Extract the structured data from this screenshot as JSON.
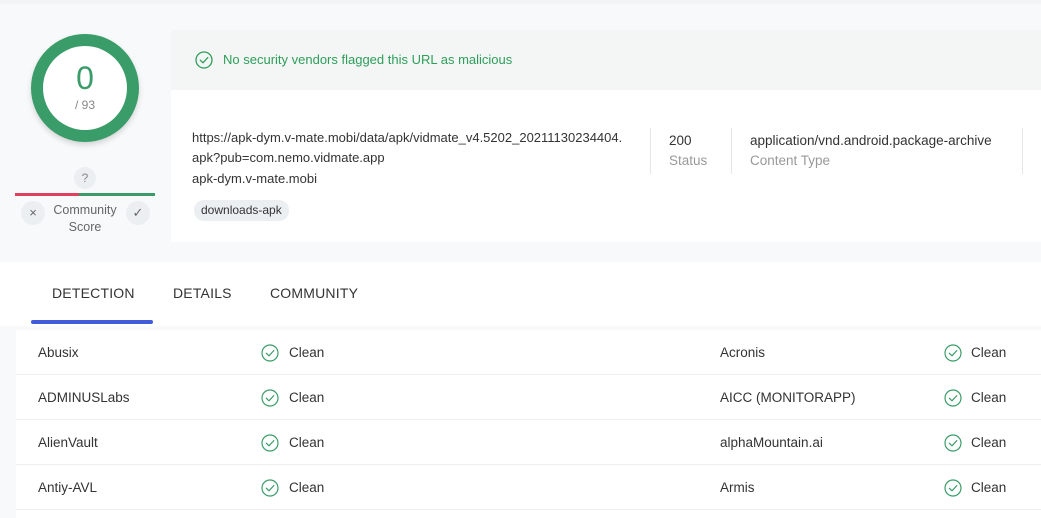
{
  "score": {
    "detections": "0",
    "total": "/ 93",
    "question": "?",
    "community_label_line1": "Community",
    "community_label_line2": "Score",
    "vote_down_symbol": "×",
    "vote_up_symbol": "✓"
  },
  "banner": {
    "text": "No security vendors flagged this URL as malicious",
    "color": "#2e9e5b"
  },
  "url_info": {
    "url": "https://apk-dym.v-mate.mobi/data/apk/vidmate_v4.5202_20211130234404.apk?pub=com.nemo.vidmate.app",
    "domain": "apk-dym.v-mate.mobi",
    "tag": "downloads-apk",
    "status_value": "200",
    "status_label": "Status",
    "content_type_value": "application/vnd.android.package-archive",
    "content_type_label": "Content Type"
  },
  "tabs": {
    "detection": "DETECTION",
    "details": "DETAILS",
    "community": "COMMUNITY",
    "active": "DETECTION"
  },
  "detections": [
    {
      "left_vendor": "Abusix",
      "left_result": "Clean",
      "right_vendor": "Acronis",
      "right_result": "Clean"
    },
    {
      "left_vendor": "ADMINUSLabs",
      "left_result": "Clean",
      "right_vendor": "AICC (MONITORAPP)",
      "right_result": "Clean"
    },
    {
      "left_vendor": "AlienVault",
      "left_result": "Clean",
      "right_vendor": "alphaMountain.ai",
      "right_result": "Clean"
    },
    {
      "left_vendor": "Antiy-AVL",
      "left_result": "Clean",
      "right_vendor": "Armis",
      "right_result": "Clean"
    }
  ],
  "colors": {
    "accent_green": "#3a9c68",
    "negative_red": "#e0405e",
    "tab_active": "#3f5bd9"
  }
}
